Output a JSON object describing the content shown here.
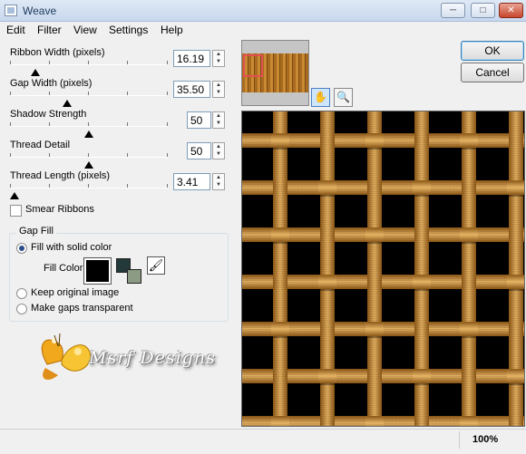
{
  "window": {
    "title": "Weave"
  },
  "menu": [
    "Edit",
    "Filter",
    "View",
    "Settings",
    "Help"
  ],
  "controls": [
    {
      "label": "Ribbon Width (pixels)",
      "value": "16.19",
      "level": 0.16,
      "spinner": true
    },
    {
      "label": "Gap Width (pixels)",
      "value": "35.50",
      "level": 0.36,
      "spinner": true
    },
    {
      "label": "Shadow Strength",
      "value": "50",
      "level": 0.5,
      "spinner": true
    },
    {
      "label": "Thread Detail",
      "value": "50",
      "level": 0.5,
      "spinner": true
    },
    {
      "label": "Thread Length (pixels)",
      "value": "3.41",
      "level": 0.03,
      "spinner": true
    }
  ],
  "smear_ribbons": {
    "label": "Smear Ribbons",
    "checked": false
  },
  "gap_fill": {
    "title": "Gap Fill",
    "options": [
      {
        "label": "Fill with solid color",
        "selected": true
      },
      {
        "label": "Keep original image",
        "selected": false
      },
      {
        "label": "Make gaps transparent",
        "selected": false
      }
    ],
    "fill_color_label": "Fill Color",
    "fill_color": "#000000",
    "swatch_dark": "#23393a",
    "swatch_light": "#8c9b84"
  },
  "buttons": {
    "ok": "OK",
    "cancel": "Cancel"
  },
  "tools": [
    "hand-icon",
    "zoom-icon"
  ],
  "watermark": "Msrf Designs",
  "status": {
    "zoom": "100%"
  },
  "colors": {
    "ribbon_mid": "#c88a35",
    "ribbon_dark": "#8a5616",
    "ribbon_light": "#e6b566",
    "gap": "#000000",
    "accent": "#2b4e8a"
  }
}
